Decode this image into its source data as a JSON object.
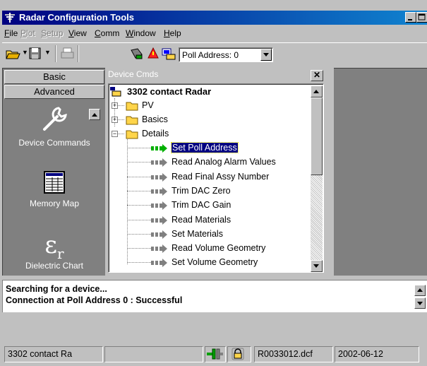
{
  "window": {
    "title": "Radar Configuration Tools"
  },
  "menu": {
    "items": [
      {
        "label": "File",
        "accel": "F",
        "rest": "ile",
        "enabled": true
      },
      {
        "label": "Plot",
        "accel": "P",
        "rest": "lot",
        "enabled": false
      },
      {
        "label": "Setup",
        "accel": "S",
        "rest": "etup",
        "enabled": false
      },
      {
        "label": "View",
        "accel": "V",
        "rest": "iew",
        "enabled": true
      },
      {
        "label": "Comm",
        "accel": "C",
        "rest": "omm",
        "enabled": true
      },
      {
        "label": "Window",
        "accel": "W",
        "rest": "indow",
        "enabled": true
      },
      {
        "label": "Help",
        "accel": "H",
        "rest": "elp",
        "enabled": true
      }
    ]
  },
  "toolbar": {
    "poll_address": "Poll Address: 0",
    "icons": [
      "open-folder-icon",
      "save-icon",
      "print-icon",
      "connect-icon",
      "alarm-icon",
      "device-icon"
    ]
  },
  "left_pane": {
    "groups": [
      "Basic",
      "Advanced"
    ],
    "tools": [
      {
        "label": "Device Commands",
        "icon": "wrench-icon"
      },
      {
        "label": "Memory Map",
        "icon": "memory-map-icon"
      },
      {
        "label": "Dielectric Chart",
        "icon": "dielectric-icon",
        "symbol": "ε",
        "subscript": "r"
      }
    ]
  },
  "device_panel": {
    "title": "Device Cmds",
    "root": "3302 contact Radar",
    "folders": [
      "PV",
      "Basics",
      "Details"
    ],
    "commands": [
      "Set Poll Address",
      "Read Analog Alarm Values",
      "Read Final Assy Number",
      "Trim DAC Zero",
      "Trim DAC Gain",
      "Read Materials",
      "Set Materials",
      "Read Volume Geometry",
      "Set Volume Geometry"
    ],
    "selected": "Set Poll Address"
  },
  "output": {
    "lines": [
      "Searching for a device...",
      "Connection at Poll Address 0 : Successful"
    ]
  },
  "status": {
    "device": "3302 contact Ra",
    "file": "R0033012.dcf",
    "date": "2002-06-12"
  },
  "colors": {
    "title_start": "#000080",
    "title_end": "#1084d0",
    "face": "#c0c0c0",
    "dark": "#808080",
    "selection": "#000080"
  }
}
